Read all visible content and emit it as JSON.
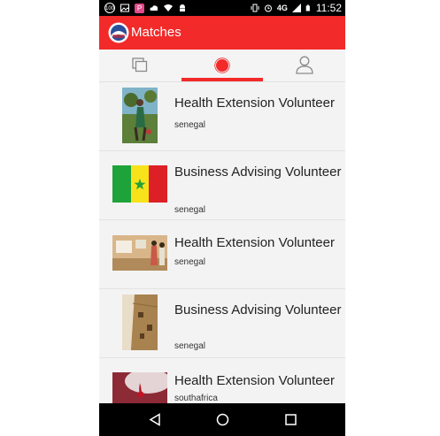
{
  "status_bar": {
    "network": "4G",
    "time": "11:52",
    "left_icons": [
      "notification-badge-icon",
      "image-icon",
      "pinterest-icon",
      "cloud-upload-icon",
      "wifi-icon",
      "android-icon"
    ],
    "right_icons": [
      "vibrate-icon",
      "alarm-icon",
      "signal-icon",
      "battery-icon"
    ]
  },
  "app_bar": {
    "title": "Matches"
  },
  "tabs": [
    {
      "icon": "gallery-icon",
      "selected": false
    },
    {
      "icon": "record-icon",
      "selected": true
    },
    {
      "icon": "profile-icon",
      "selected": false
    }
  ],
  "matches": [
    {
      "title": "Health Extension Volunteer",
      "location": "senegal",
      "thumb": "volunteer-photo"
    },
    {
      "title": "Business Advising Volunteer",
      "location": "senegal",
      "thumb": "senegal-flag"
    },
    {
      "title": "Health Extension Volunteer",
      "location": "senegal",
      "thumb": "classroom-photo"
    },
    {
      "title": "Business Advising Volunteer",
      "location": "senegal",
      "thumb": "cliff-dwelling-photo"
    },
    {
      "title": "Health Extension Volunteer",
      "location": "southafrica",
      "thumb": "blood-drop-photo"
    }
  ],
  "colors": {
    "accent": "#f22a2a",
    "status_bar": "#000000",
    "nav_bar": "#000000"
  },
  "nav_bar": {
    "icons": [
      "back-icon",
      "home-icon",
      "recents-icon"
    ]
  }
}
